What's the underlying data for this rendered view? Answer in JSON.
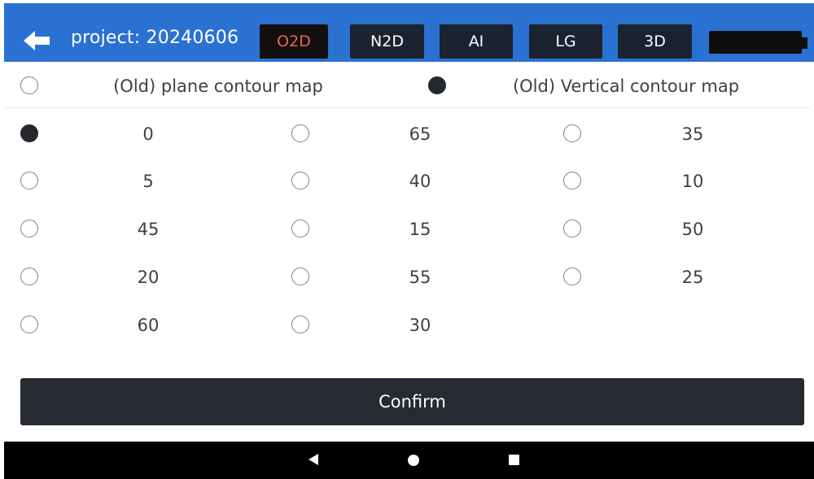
{
  "header": {
    "title": "project: 20240606",
    "tabs": [
      {
        "label": "O2D",
        "active": true,
        "color": "#e8684a"
      },
      {
        "label": "N2D",
        "active": false,
        "color": "#ffffff"
      },
      {
        "label": "AI",
        "active": false,
        "color": "#ffffff"
      },
      {
        "label": "LG",
        "active": false,
        "color": "#ffffff"
      },
      {
        "label": "3D",
        "active": false,
        "color": "#ffffff"
      }
    ]
  },
  "map_type": {
    "options": [
      {
        "label": "(Old) plane contour map",
        "selected": false
      },
      {
        "label": "(Old) Vertical contour map",
        "selected": true
      }
    ]
  },
  "angles": {
    "columns": [
      [
        {
          "value": "0",
          "selected": true
        },
        {
          "value": "5",
          "selected": false
        },
        {
          "value": "45",
          "selected": false
        },
        {
          "value": "20",
          "selected": false
        },
        {
          "value": "60",
          "selected": false
        }
      ],
      [
        {
          "value": "65",
          "selected": false
        },
        {
          "value": "40",
          "selected": false
        },
        {
          "value": "15",
          "selected": false
        },
        {
          "value": "55",
          "selected": false
        },
        {
          "value": "30",
          "selected": false
        }
      ],
      [
        {
          "value": "35",
          "selected": false
        },
        {
          "value": "10",
          "selected": false
        },
        {
          "value": "50",
          "selected": false
        },
        {
          "value": "25",
          "selected": false
        }
      ]
    ]
  },
  "confirm_label": "Confirm",
  "colors": {
    "header_bg": "#2a71d2",
    "active_tab_text": "#e8684a",
    "confirm_bg": "#262a31"
  },
  "icons": {
    "back": "arrow-left-icon",
    "battery": "battery-icon",
    "nav_back": "triangle-back-icon",
    "nav_home": "circle-home-icon",
    "nav_recent": "square-recent-icon"
  }
}
